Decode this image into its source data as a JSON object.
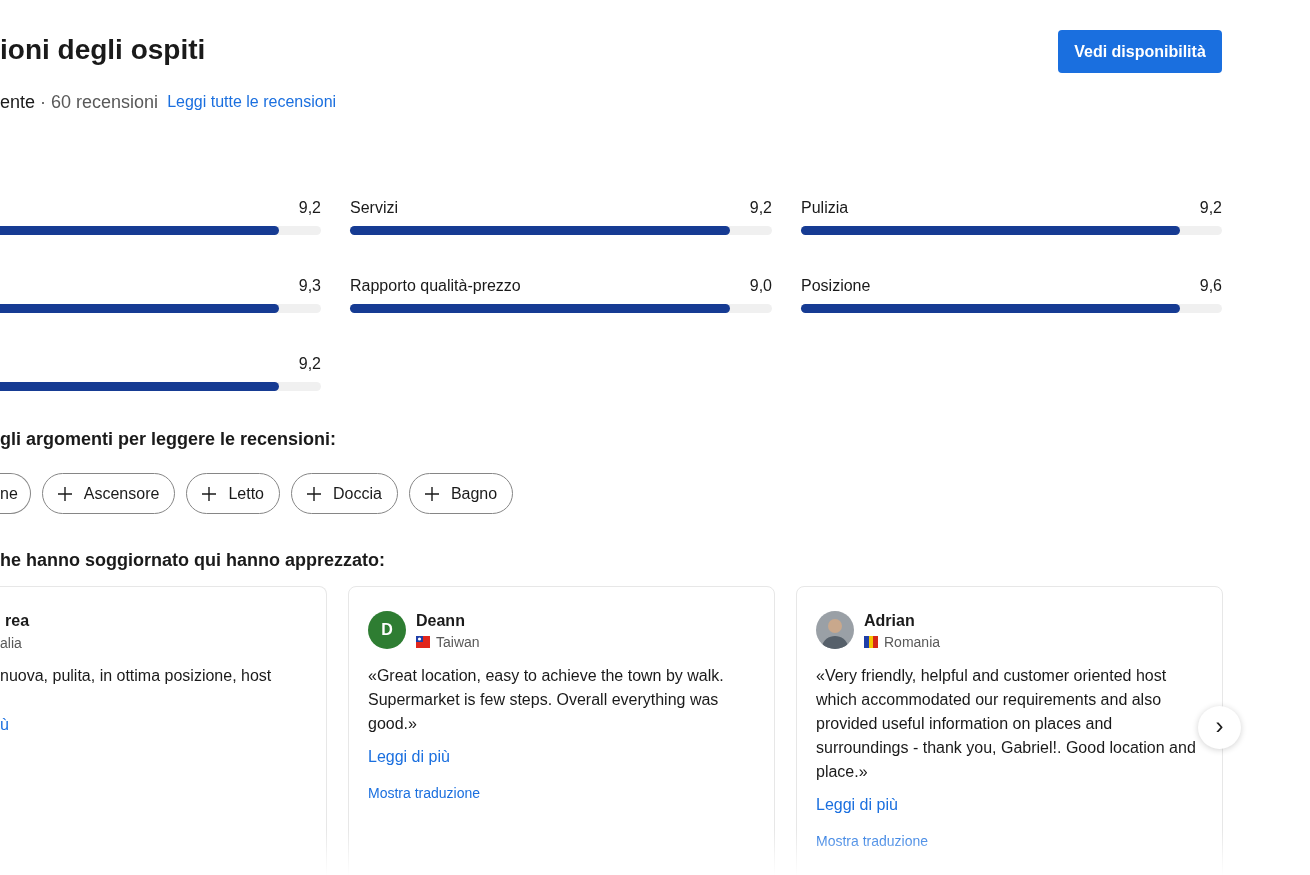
{
  "title": "ioni degli ospiti",
  "availability_button": "Vedi disponibilità",
  "summary": {
    "rating_fragment": "ente",
    "count": "· 60 recensioni",
    "link": "Leggi tutte le recensioni"
  },
  "scores": [
    {
      "score": "9,2",
      "level": 0.9
    },
    {
      "label": "Servizi",
      "score": "9,2",
      "level": 0.9
    },
    {
      "label": "Pulizia",
      "score": "9,2",
      "level": 0.9
    },
    {
      "score": "9,3",
      "level": 0.9
    },
    {
      "label": "Rapporto qualità-prezzo",
      "score": "9,0",
      "level": 0.9
    },
    {
      "label": "Posizione",
      "score": "9,6",
      "level": 0.9
    },
    {
      "score": "9,2",
      "level": 0.9
    }
  ],
  "topics_heading": "gli argomenti per leggere le recensioni:",
  "topics": [
    {
      "label": "ne",
      "kind": "cut"
    },
    {
      "label": "Ascensore",
      "kind": "full"
    },
    {
      "label": "Letto",
      "kind": "full"
    },
    {
      "label": "Doccia",
      "kind": "full"
    },
    {
      "label": "Bagno",
      "kind": "full"
    }
  ],
  "liked_heading": "he hanno soggiornato qui hanno apprezzato:",
  "reviews": [
    {
      "kind": "cut",
      "name": "rea",
      "country": "alia",
      "text": "nuova, pulita, in ottima posizione, host",
      "more": "ù"
    },
    {
      "kind": "full",
      "avatar": {
        "kind": "letter",
        "letter": "D",
        "color": "#2e7d32"
      },
      "flag": {
        "kind": "canton"
      },
      "name": "Deann",
      "country": "Taiwan",
      "text": "«Great location, easy to achieve the town by walk. Supermarket is few steps. Overall everything was good.»",
      "more": "Leggi di più",
      "translate": "Mostra traduzione"
    },
    {
      "kind": "full",
      "avatar": {
        "kind": "photo"
      },
      "flag": {
        "kind": "tricolor"
      },
      "name": "Adrian",
      "country": "Romania",
      "text": "«Very friendly, helpful and customer oriented host which accommodated our requirements and also provided useful information on places and surroundings - thank you, Gabriel!. Good location and place.»",
      "more": "Leggi di più",
      "translate": "Mostra traduzione"
    }
  ],
  "next_button": "›"
}
